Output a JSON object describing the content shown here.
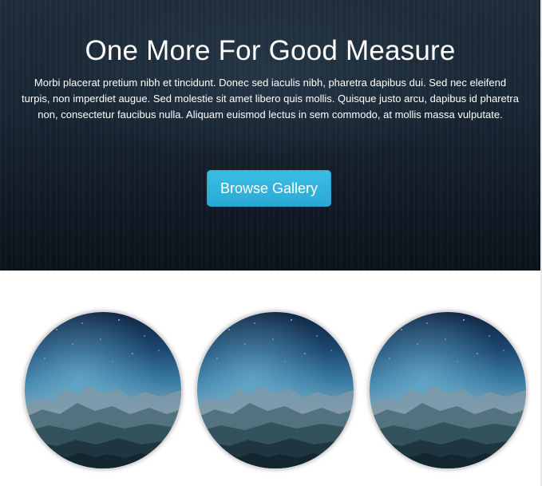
{
  "hero": {
    "title": "One More For Good Measure",
    "body": "Morbi placerat pretium nibh et tincidunt. Donec sed iaculis nibh, pharetra dapibus dui. Sed nec eleifend turpis, non imperdiet augue. Sed molestie sit amet libero quis mollis. Quisque justo arcu, dapibus id pharetra non, consectetur faucibus nulla. Aliquam euismod lectus in sem commodo, at mollis massa vulputate.",
    "button_label": "Browse Gallery",
    "button_color": "#33b5e0",
    "background_color": "#1a2836"
  },
  "gallery": {
    "items": [
      {
        "image": "mountain-night-sky"
      },
      {
        "image": "mountain-night-sky"
      },
      {
        "image": "mountain-night-sky"
      }
    ]
  }
}
